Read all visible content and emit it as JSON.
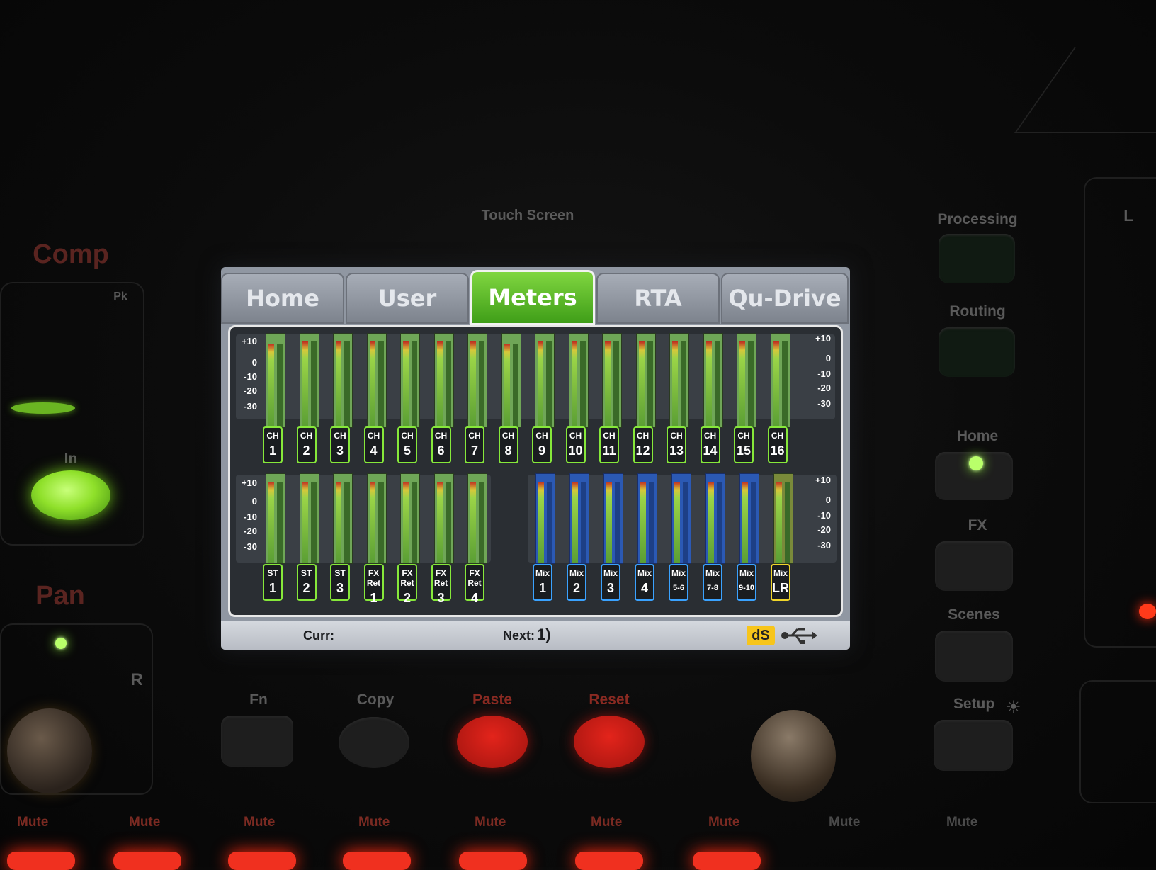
{
  "console": {
    "touch_screen_label": "Touch Screen",
    "comp_label": "Comp",
    "pk_label": "Pk",
    "in_label": "In",
    "pan_label": "Pan",
    "r_label": "R",
    "l_label": "L",
    "right_panel": {
      "processing": "Processing",
      "routing": "Routing",
      "home": "Home",
      "fx": "FX",
      "scenes": "Scenes",
      "setup": "Setup"
    },
    "soft_keys": [
      "Fn",
      "Copy",
      "Paste",
      "Reset"
    ],
    "mute_label": "Mute"
  },
  "screen": {
    "tabs": [
      {
        "label": "Home",
        "active": false
      },
      {
        "label": "User",
        "active": false
      },
      {
        "label": "Meters",
        "active": true
      },
      {
        "label": "RTA",
        "active": false
      },
      {
        "label": "Qu-Drive",
        "active": false
      }
    ],
    "scale_labels": [
      "+10",
      "0",
      "-10",
      "-20",
      "-30"
    ],
    "input_channels": [
      {
        "top": "CH",
        "num": "1",
        "level": 0.88
      },
      {
        "top": "CH",
        "num": "2",
        "level": 0.9
      },
      {
        "top": "CH",
        "num": "3",
        "level": 0.9
      },
      {
        "top": "CH",
        "num": "4",
        "level": 0.9
      },
      {
        "top": "CH",
        "num": "5",
        "level": 0.9
      },
      {
        "top": "CH",
        "num": "6",
        "level": 0.9
      },
      {
        "top": "CH",
        "num": "7",
        "level": 0.9
      },
      {
        "top": "CH",
        "num": "8",
        "level": 0.88
      },
      {
        "top": "CH",
        "num": "9",
        "level": 0.9
      },
      {
        "top": "CH",
        "num": "10",
        "level": 0.9
      },
      {
        "top": "CH",
        "num": "11",
        "level": 0.9
      },
      {
        "top": "CH",
        "num": "12",
        "level": 0.9
      },
      {
        "top": "CH",
        "num": "13",
        "level": 0.9
      },
      {
        "top": "CH",
        "num": "14",
        "level": 0.9
      },
      {
        "top": "CH",
        "num": "15",
        "level": 0.9
      },
      {
        "top": "CH",
        "num": "16",
        "level": 0.9
      }
    ],
    "stereo_returns": [
      {
        "top": "ST",
        "num": "1"
      },
      {
        "top": "ST",
        "num": "2"
      },
      {
        "top": "ST",
        "num": "3"
      },
      {
        "top": "FX Ret",
        "num": "1"
      },
      {
        "top": "FX Ret",
        "num": "2"
      },
      {
        "top": "FX Ret",
        "num": "3"
      },
      {
        "top": "FX Ret",
        "num": "4"
      }
    ],
    "mixes": [
      {
        "top": "Mix",
        "num": "1",
        "style": "blue"
      },
      {
        "top": "Mix",
        "num": "2",
        "style": "blue"
      },
      {
        "top": "Mix",
        "num": "3",
        "style": "blue"
      },
      {
        "top": "Mix",
        "num": "4",
        "style": "blue"
      },
      {
        "top": "Mix",
        "num": "5-6",
        "style": "blue"
      },
      {
        "top": "Mix",
        "num": "7-8",
        "style": "blue"
      },
      {
        "top": "Mix",
        "num": "9-10",
        "style": "blue"
      },
      {
        "top": "Mix",
        "num": "LR",
        "style": "yellow"
      }
    ],
    "status": {
      "curr_label": "Curr:",
      "next_label": "Next:",
      "next_value": "1)",
      "ds_badge": "dS",
      "usb_icon": "usb-icon"
    }
  }
}
